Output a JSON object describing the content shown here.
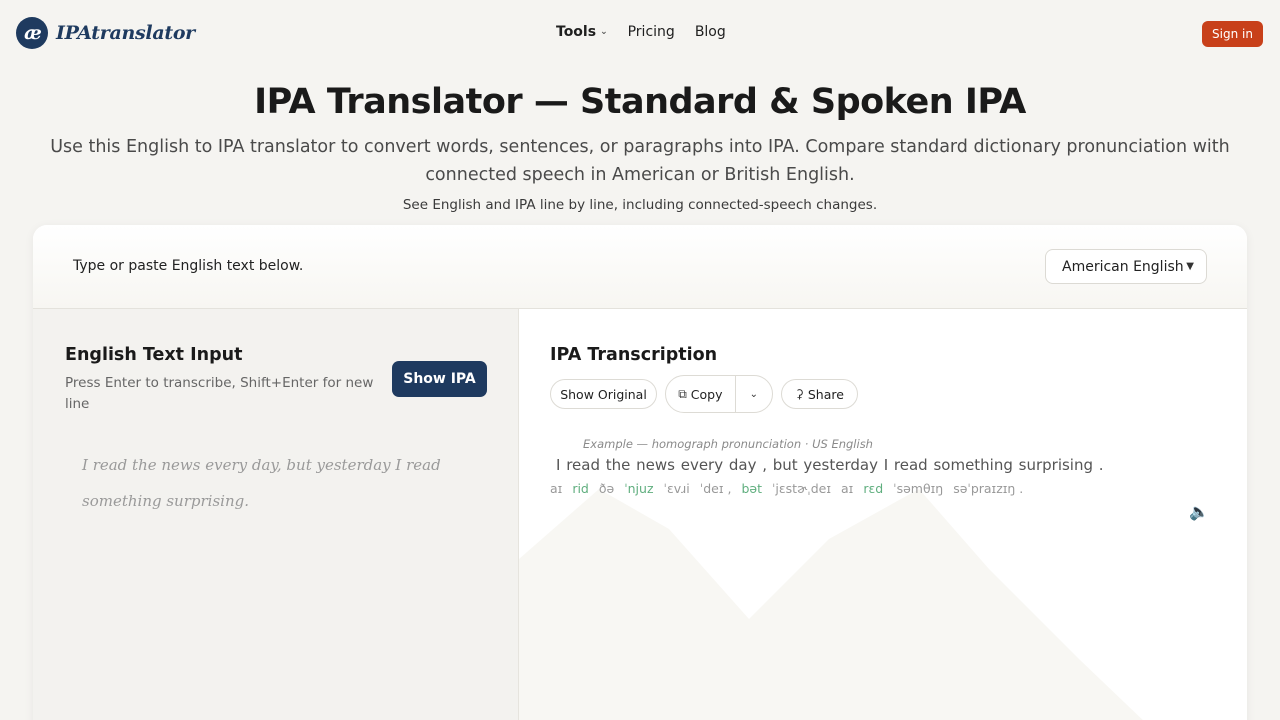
{
  "brand": {
    "mark": "æ",
    "name": "IPAtranslator",
    "color": "#1e3a5f"
  },
  "nav": {
    "tools": "Tools",
    "pricing": "Pricing",
    "blog": "Blog"
  },
  "header": {
    "signin": "Sign in",
    "signin_color": "#c8401a"
  },
  "hero": {
    "title": "IPA Translator — Standard & Spoken IPA",
    "subtitle": "Use this English to IPA translator to convert words, sentences, or paragraphs into IPA. Compare standard dictionary pronunciation with connected speech in American or British English.",
    "note": "See English and IPA line by line, including connected-speech changes."
  },
  "card": {
    "instruction": "Type or paste English text below.",
    "language": {
      "selected": "American English"
    }
  },
  "input_panel": {
    "title": "English Text Input",
    "hint": "Press Enter to transcribe, Shift+Enter for new line",
    "button": "Show IPA",
    "placeholder": "I read the news every day, but yesterday I read something surprising."
  },
  "output_panel": {
    "title": "IPA Transcription",
    "show_original": "Show Original",
    "copy": "Copy",
    "share": "Share",
    "example_caption": "Example — homograph pronunciation · US English",
    "sentence": "I  read the news every  day , but yesterday  I  read something surprising .",
    "ipa_tokens": [
      {
        "text": "aɪ",
        "highlight": false
      },
      {
        "text": "rid",
        "highlight": true
      },
      {
        "text": "ðə",
        "highlight": false
      },
      {
        "text": "ˈnjuz",
        "highlight": true
      },
      {
        "text": "ˈɛvɹi",
        "highlight": false
      },
      {
        "text": "ˈdeɪ ,",
        "highlight": false
      },
      {
        "text": "bət",
        "highlight": true
      },
      {
        "text": "ˈjɛstɚˌdeɪ",
        "highlight": false
      },
      {
        "text": "aɪ",
        "highlight": false
      },
      {
        "text": "rɛd",
        "highlight": true
      },
      {
        "text": "ˈsəmθɪŋ",
        "highlight": false
      },
      {
        "text": "səˈpraɪzɪŋ .",
        "highlight": false
      }
    ],
    "highlight_color": "#5fae7e"
  }
}
